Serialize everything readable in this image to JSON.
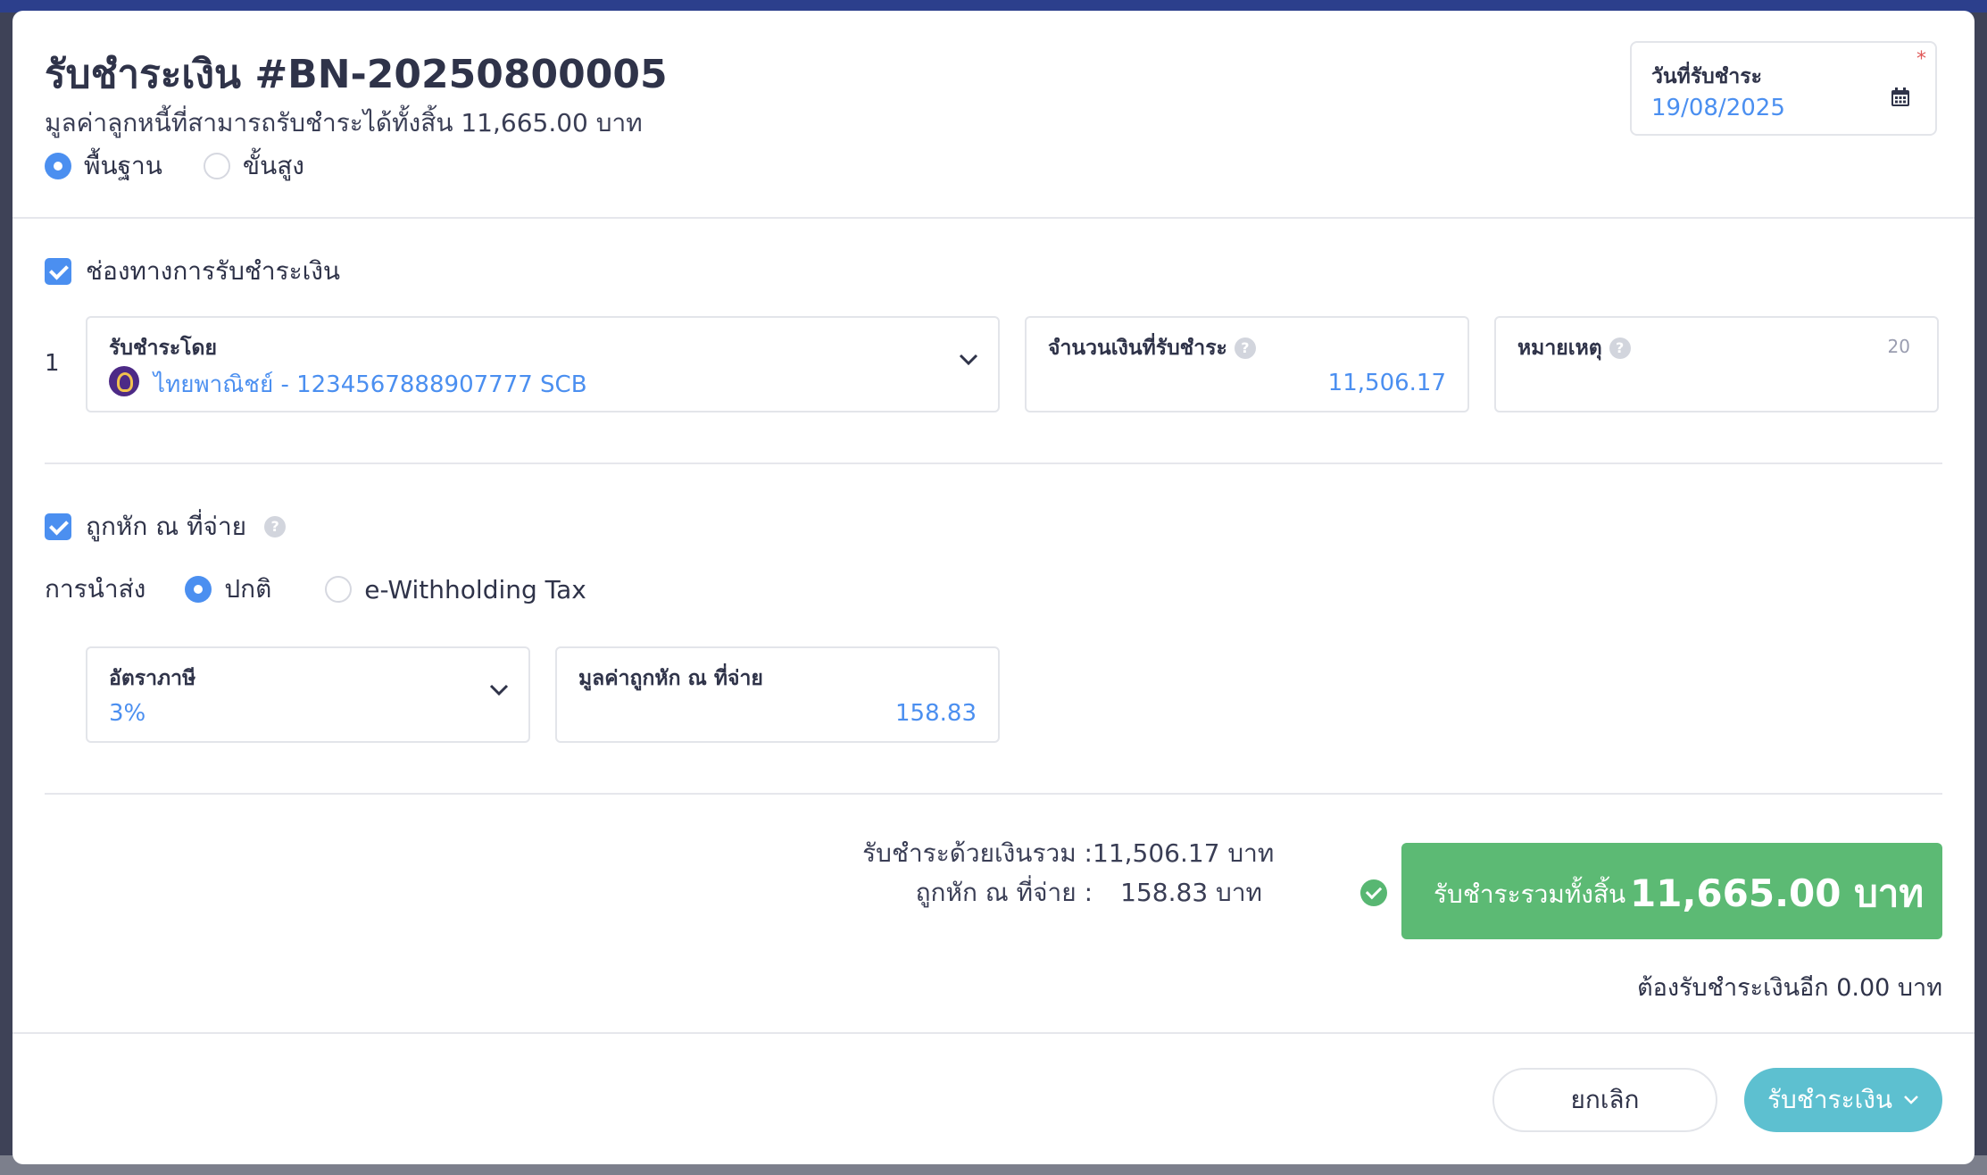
{
  "modal": {
    "title": "รับชำระเงิน #BN-20250800005",
    "subtitle": "มูลค่าลูกหนี้ที่สามารถรับชำระได้ทั้งสิ้น 11,665.00 บาท",
    "mode_options": [
      {
        "label": "พื้นฐาน",
        "selected": true
      },
      {
        "label": "ขั้นสูง",
        "selected": false
      }
    ]
  },
  "date_field": {
    "label": "วันที่รับชำระ",
    "value": "19/08/2025",
    "required_mark": "*"
  },
  "payment_channel": {
    "section_label": "ช่องทางการรับชำระเงิน",
    "checked": true,
    "row_index": "1",
    "received_by": {
      "label": "รับชำระโดย",
      "value": "ไทยพาณิชย์ - 1234567888907777 SCB"
    },
    "amount": {
      "label": "จำนวนเงินที่รับชำระ",
      "value": "11,506.17",
      "help": "?"
    },
    "note": {
      "label": "หมายเหตุ",
      "counter": "20",
      "help": "?"
    }
  },
  "withholding": {
    "section_label": "ถูกหัก ณ ที่จ่าย",
    "checked": true,
    "help": "?",
    "submission_label": "การนำส่ง",
    "submission_options": [
      {
        "label": "ปกติ",
        "selected": true
      },
      {
        "label": "e-Withholding Tax",
        "selected": false
      }
    ],
    "tax_rate": {
      "label": "อัตราภาษี",
      "value": "3%"
    },
    "withheld_amount": {
      "label": "มูลค่าถูกหัก ณ ที่จ่าย",
      "value": "158.83"
    }
  },
  "summary": {
    "cash_label": "รับชำระด้วยเงินรวม :",
    "cash_value": "11,506.17 บาท",
    "withheld_label": "ถูกหัก ณ ที่จ่าย :",
    "withheld_value": "158.83 บาท",
    "total_label": "รับชำระรวมทั้งสิ้น",
    "total_value": "11,665.00 บาท",
    "remaining": "ต้องรับชำระเงินอีก 0.00 บาท"
  },
  "footer": {
    "cancel_label": "ยกเลิก",
    "submit_label": "รับชำระเงิน"
  },
  "colors": {
    "accent": "#4b8ff0",
    "success": "#5cba74",
    "submit": "#5dc0d0"
  }
}
